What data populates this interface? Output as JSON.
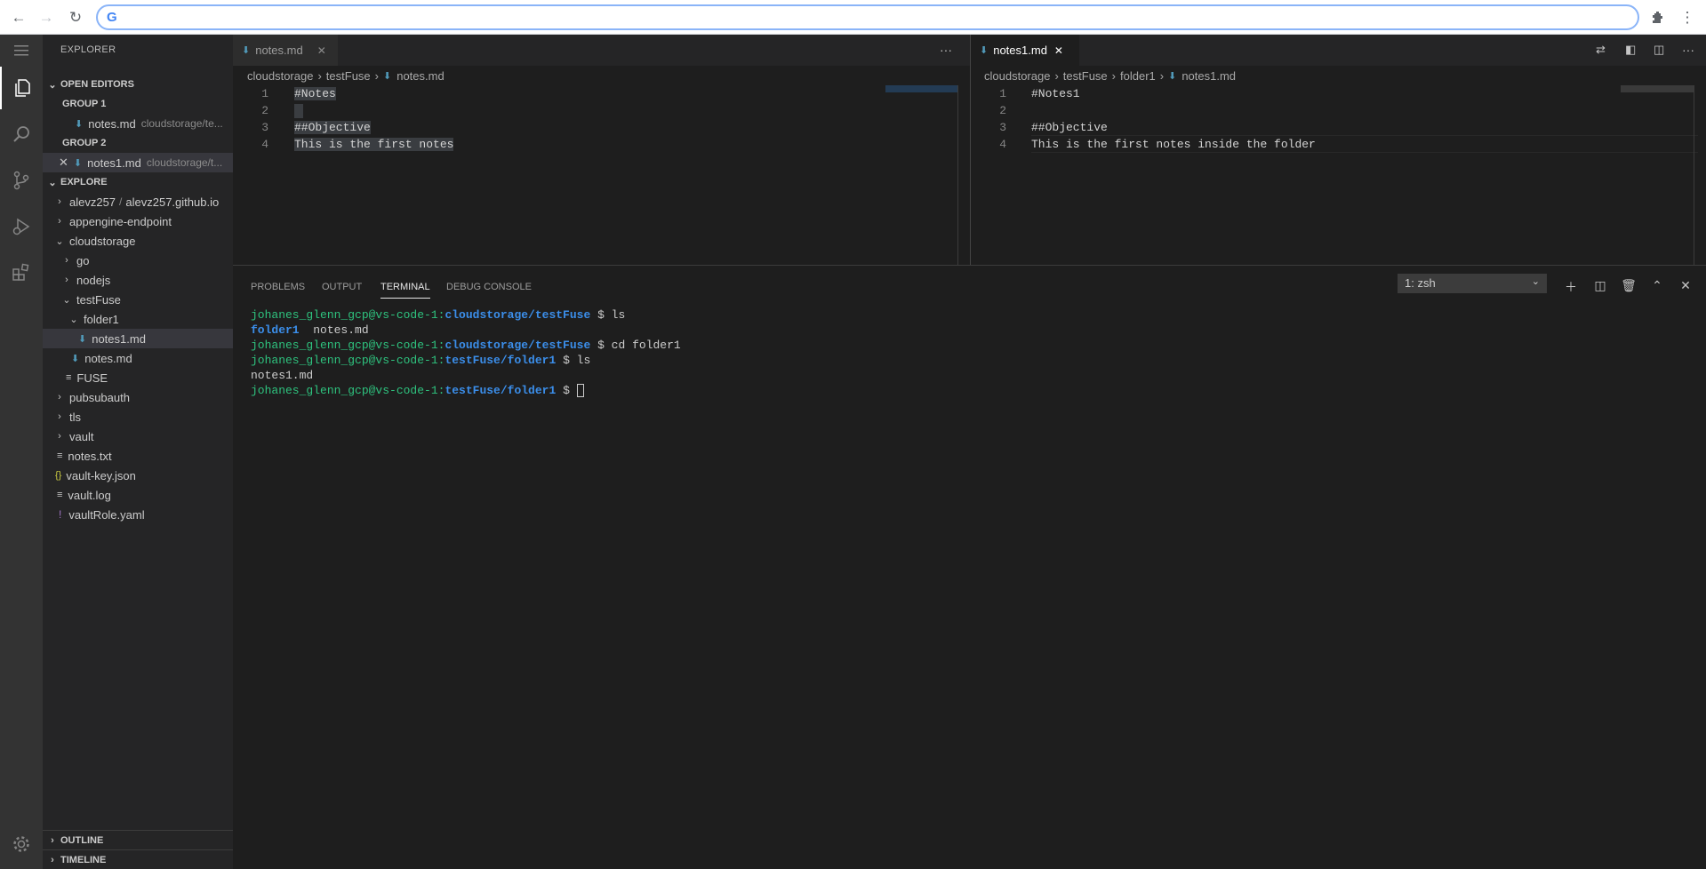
{
  "browser": {
    "back": "←",
    "forward": "→",
    "reload": "↻",
    "omnibox_value": "",
    "menu": "⋮"
  },
  "sidebar": {
    "title": "EXPLORER",
    "open_editors": {
      "header": "OPEN EDITORS",
      "group1": "GROUP 1",
      "group1_file": "notes.md",
      "group1_path": "cloudstorage/te...",
      "group2": "GROUP 2",
      "group2_file": "notes1.md",
      "group2_path": "cloudstorage/t..."
    },
    "explore_header": "EXPLORE",
    "tree": {
      "repo_owner": "alevz257",
      "repo_sep": "/",
      "repo_name": "alevz257.github.io",
      "appengine": "appengine-endpoint",
      "cloudstorage": "cloudstorage",
      "go": "go",
      "nodejs": "nodejs",
      "testfuse": "testFuse",
      "folder1": "folder1",
      "notes1": "notes1.md",
      "notes": "notes.md",
      "fuse": "FUSE",
      "pubsubauth": "pubsubauth",
      "tls": "tls",
      "vault": "vault",
      "notes_txt": "notes.txt",
      "vault_key": "vault-key.json",
      "vault_log": "vault.log",
      "vault_role": "vaultRole.yaml"
    },
    "outline": "OUTLINE",
    "timeline": "TIMELINE"
  },
  "editor_left": {
    "tab": "notes.md",
    "crumbs": [
      "cloudstorage",
      "testFuse",
      "notes.md"
    ],
    "lines": [
      "1",
      "2",
      "3",
      "4"
    ],
    "code": [
      "#Notes",
      "",
      "##Objective",
      "This is the first notes"
    ]
  },
  "editor_right": {
    "tab": "notes1.md",
    "crumbs": [
      "cloudstorage",
      "testFuse",
      "folder1",
      "notes1.md"
    ],
    "lines": [
      "1",
      "2",
      "3",
      "4"
    ],
    "code": [
      "#Notes1",
      "",
      "##Objective",
      "This is the first notes inside the folder"
    ]
  },
  "panel": {
    "tabs": [
      "PROBLEMS",
      "OUTPUT",
      "TERMINAL",
      "DEBUG CONSOLE"
    ],
    "terminal_select": "1: zsh",
    "terminal": {
      "l1_user": "johanes_glenn_gcp@vs-code-1:",
      "l1_path": "cloudstorage/testFuse",
      "l1_cmd": " $ ls",
      "l2_dir": "folder1",
      "l2_file": "  notes.md",
      "l3_user": "johanes_glenn_gcp@vs-code-1:",
      "l3_path": "cloudstorage/testFuse",
      "l3_cmd": " $ cd folder1",
      "l4_user": "johanes_glenn_gcp@vs-code-1:",
      "l4_path": "testFuse/folder1",
      "l4_cmd": " $ ls",
      "l5": "notes1.md",
      "l6_user": "johanes_glenn_gcp@vs-code-1:",
      "l6_path": "testFuse/folder1",
      "l6_cmd": " $ "
    }
  }
}
